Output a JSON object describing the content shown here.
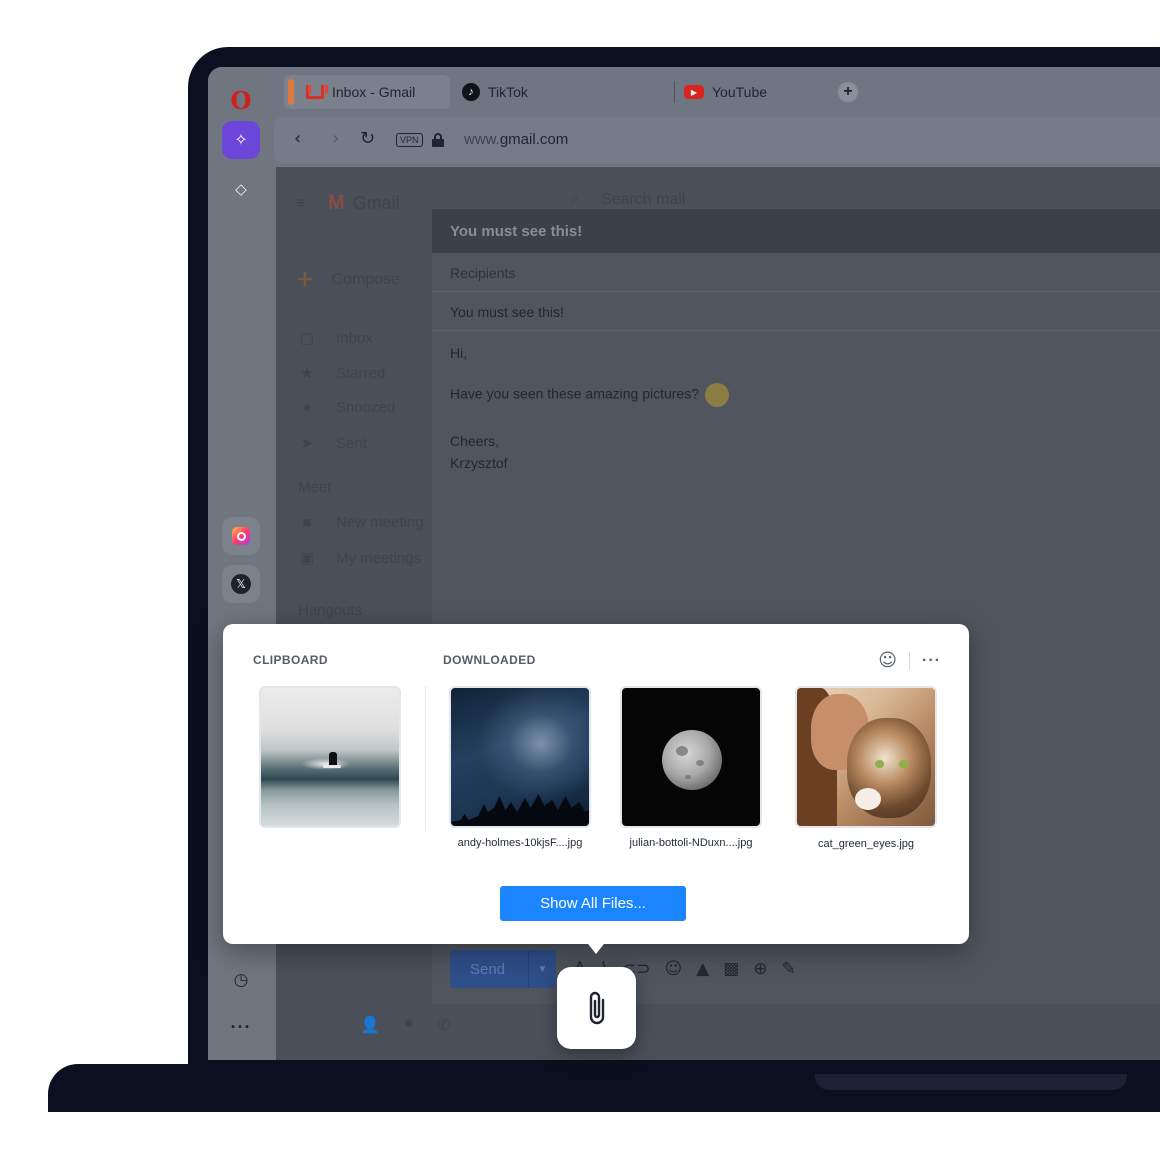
{
  "browser": {
    "tabs": [
      {
        "label": "Inbox - Gmail",
        "icon": "gmail-icon",
        "active": true
      },
      {
        "label": "TikTok",
        "icon": "tiktok-icon",
        "active": false
      },
      {
        "label": "YouTube",
        "icon": "youtube-icon",
        "active": false
      }
    ],
    "new_tab_symbol": "+",
    "url_prefix": "www.",
    "url_host": "gmail.com",
    "vpn_label": "VPN",
    "nav": {
      "back": "‹",
      "forward": "›",
      "reload": "↻"
    }
  },
  "sidebar": {
    "logo": "O",
    "aria_symbol": "✧",
    "diamond_symbol": "◇",
    "x_symbol": "𝕏",
    "clock_symbol": "◷",
    "more_symbol": "···",
    "colors": {
      "aria": "#6b46d8",
      "opera": "#d41f1f"
    }
  },
  "gmail": {
    "app_name": "Gmail",
    "search_placeholder": "Search mail",
    "compose_label": "Compose",
    "nav": [
      {
        "label": "Inbox",
        "icon": "inbox-icon",
        "symbol": "▢"
      },
      {
        "label": "Starred",
        "icon": "star-icon",
        "symbol": "★"
      },
      {
        "label": "Snoozed",
        "icon": "clock-icon",
        "symbol": "●"
      },
      {
        "label": "Sent",
        "icon": "send-icon",
        "symbol": "➤"
      }
    ],
    "meet_heading": "Meet",
    "meet": [
      {
        "label": "New meeting",
        "icon": "video-icon",
        "symbol": "■"
      },
      {
        "label": "My meetings",
        "icon": "calendar-icon",
        "symbol": "▣"
      }
    ],
    "hangouts_heading": "Hangouts"
  },
  "compose": {
    "title": "You must see this!",
    "recipients_placeholder": "Recipients",
    "subject": "You must see this!",
    "greeting": "Hi,",
    "body": "Have you seen these amazing pictures?",
    "signoff": "Cheers,",
    "signature": "Krzysztof",
    "send_label": "Send",
    "send_caret": "▼"
  },
  "attachment_popup": {
    "clipboard_label": "CLIPBOARD",
    "downloaded_label": "DOWNLOADED",
    "emoji_symbol": "☺",
    "more_symbol": "···",
    "clipboard_items": [
      {
        "name": "",
        "preview": "surfer-photo"
      }
    ],
    "downloaded_items": [
      {
        "name": "andy-holmes-10kjsF....jpg",
        "preview": "milky-way-photo"
      },
      {
        "name": "julian-bottoli-NDuxn....jpg",
        "preview": "moon-photo"
      },
      {
        "name": "cat_green_eyes.jpg",
        "preview": "cat-photo"
      }
    ],
    "show_all_label": "Show All Files...",
    "accent": "#1b84ff"
  }
}
